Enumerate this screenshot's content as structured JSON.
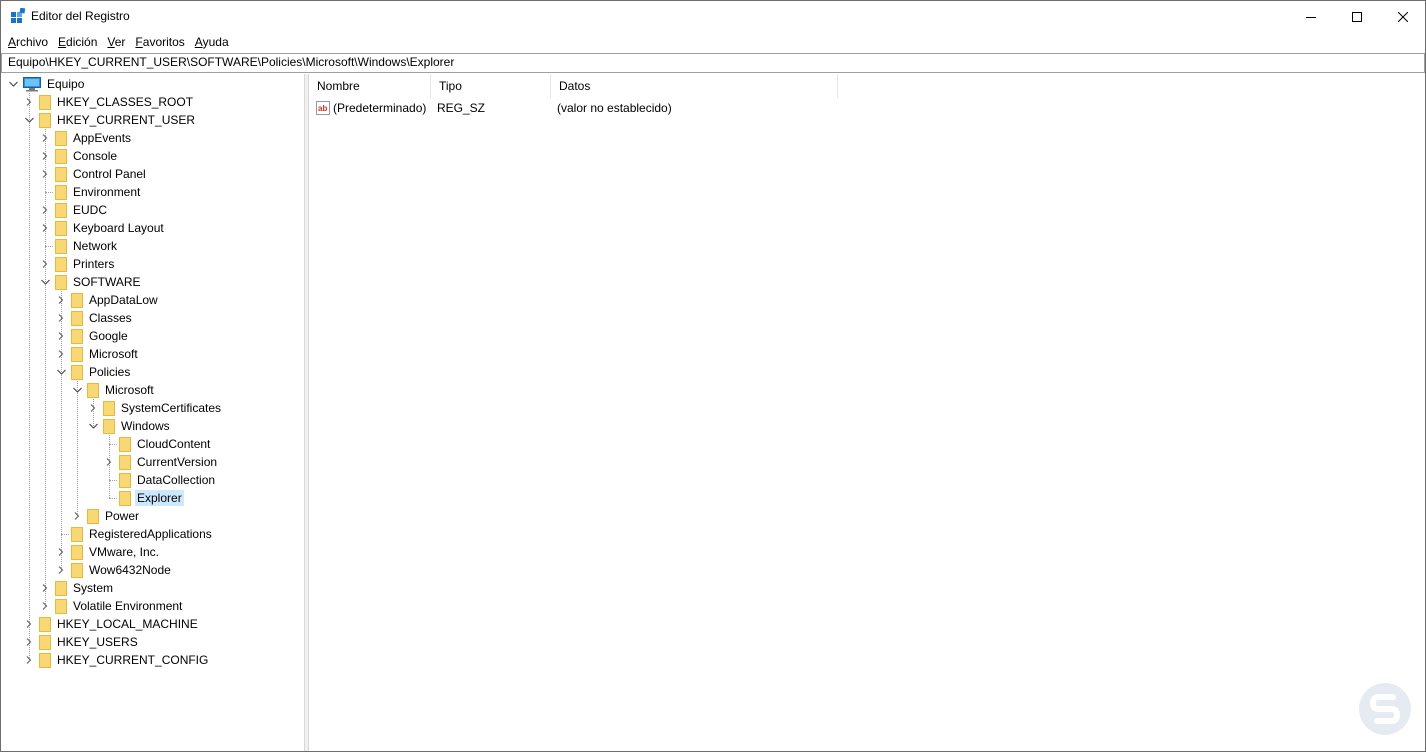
{
  "window": {
    "title": "Editor del Registro"
  },
  "menu": [
    {
      "label": "Archivo",
      "acc": "A",
      "rest": "rchivo"
    },
    {
      "label": "Edición",
      "acc": "E",
      "rest": "dición"
    },
    {
      "label": "Ver",
      "acc": "V",
      "rest": "er"
    },
    {
      "label": "Favoritos",
      "acc": "F",
      "rest": "avoritos"
    },
    {
      "label": "Ayuda",
      "acc": "A",
      "rest": "yuda"
    }
  ],
  "address": "Equipo\\HKEY_CURRENT_USER\\SOFTWARE\\Policies\\Microsoft\\Windows\\Explorer",
  "tree": [
    {
      "label": "Equipo",
      "level": 0,
      "expander": "open",
      "icon": "computer-icon"
    },
    {
      "label": "HKEY_CLASSES_ROOT",
      "level": 1,
      "expander": "closed"
    },
    {
      "label": "HKEY_CURRENT_USER",
      "level": 1,
      "expander": "open"
    },
    {
      "label": "AppEvents",
      "level": 2,
      "expander": "closed"
    },
    {
      "label": "Console",
      "level": 2,
      "expander": "closed"
    },
    {
      "label": "Control Panel",
      "level": 2,
      "expander": "closed"
    },
    {
      "label": "Environment",
      "level": 2,
      "expander": "none"
    },
    {
      "label": "EUDC",
      "level": 2,
      "expander": "closed"
    },
    {
      "label": "Keyboard Layout",
      "level": 2,
      "expander": "closed"
    },
    {
      "label": "Network",
      "level": 2,
      "expander": "none"
    },
    {
      "label": "Printers",
      "level": 2,
      "expander": "closed"
    },
    {
      "label": "SOFTWARE",
      "level": 2,
      "expander": "open"
    },
    {
      "label": "AppDataLow",
      "level": 3,
      "expander": "closed"
    },
    {
      "label": "Classes",
      "level": 3,
      "expander": "closed"
    },
    {
      "label": "Google",
      "level": 3,
      "expander": "closed"
    },
    {
      "label": "Microsoft",
      "level": 3,
      "expander": "closed"
    },
    {
      "label": "Policies",
      "level": 3,
      "expander": "open"
    },
    {
      "label": "Microsoft",
      "level": 4,
      "expander": "open"
    },
    {
      "label": "SystemCertificates",
      "level": 5,
      "expander": "closed"
    },
    {
      "label": "Windows",
      "level": 5,
      "expander": "open"
    },
    {
      "label": "CloudContent",
      "level": 6,
      "expander": "none"
    },
    {
      "label": "CurrentVersion",
      "level": 6,
      "expander": "closed"
    },
    {
      "label": "DataCollection",
      "level": 6,
      "expander": "none"
    },
    {
      "label": "Explorer",
      "level": 6,
      "expander": "none",
      "selected": true
    },
    {
      "label": "Power",
      "level": 4,
      "expander": "closed"
    },
    {
      "label": "RegisteredApplications",
      "level": 3,
      "expander": "none"
    },
    {
      "label": "VMware, Inc.",
      "level": 3,
      "expander": "closed"
    },
    {
      "label": "Wow6432Node",
      "level": 3,
      "expander": "closed"
    },
    {
      "label": "System",
      "level": 2,
      "expander": "closed"
    },
    {
      "label": "Volatile Environment",
      "level": 2,
      "expander": "closed"
    },
    {
      "label": "HKEY_LOCAL_MACHINE",
      "level": 1,
      "expander": "closed"
    },
    {
      "label": "HKEY_USERS",
      "level": 1,
      "expander": "closed"
    },
    {
      "label": "HKEY_CURRENT_CONFIG",
      "level": 1,
      "expander": "closed"
    }
  ],
  "list": {
    "columns": [
      "Nombre",
      "Tipo",
      "Datos"
    ],
    "rows": [
      {
        "name": "(Predeterminado)",
        "type": "REG_SZ",
        "data": "(valor no establecido)",
        "icon": "string-value-icon"
      }
    ]
  },
  "colors": {
    "selection": "#cce8ff",
    "folder": "#f8d775"
  }
}
